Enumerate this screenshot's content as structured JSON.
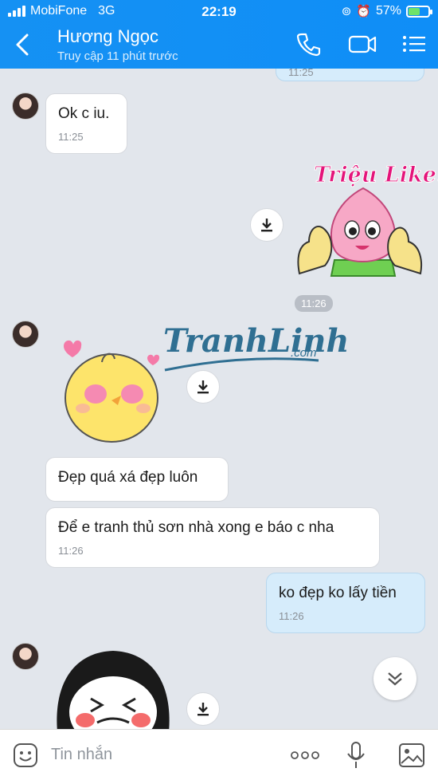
{
  "status": {
    "carrier": "MobiFone",
    "network": "3G",
    "time": "22:19",
    "battery": "57%"
  },
  "header": {
    "name": "Hương Ngọc",
    "subtitle": "Truy cập 11 phút trước"
  },
  "messages": {
    "m0_time": "11:25",
    "m1_text": "Ok c iu.",
    "m1_time": "11:25",
    "sticker1_text": "Triệu Like!",
    "chip_time": "11:26",
    "watermark": "TranhLinh",
    "watermark_dot": ".com",
    "m2_text": "Đẹp quá xá đẹp luôn",
    "m3_text": "Để e tranh thủ sơn nhà xong e báo c nha",
    "m3_time": "11:26",
    "m4_text": "ko đẹp ko lấy tiền",
    "m4_time": "11:26"
  },
  "input": {
    "placeholder": "Tin nhắn"
  },
  "colors": {
    "header": "#1591f3",
    "chat_bg": "#e2e6ec",
    "my_bubble": "#d6ecfb"
  }
}
